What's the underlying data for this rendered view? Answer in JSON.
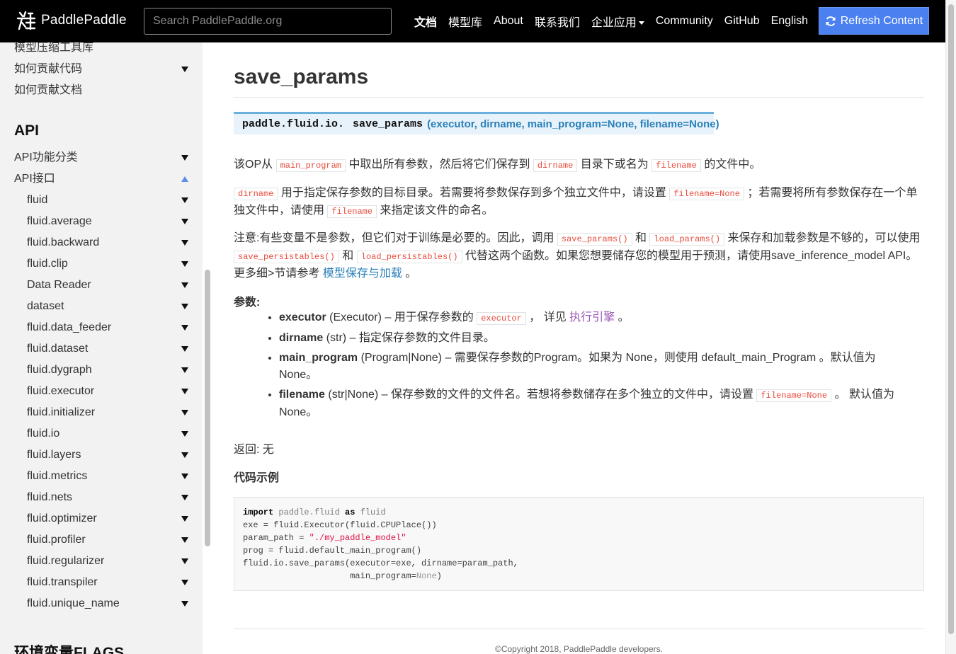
{
  "header": {
    "logo_text": "PaddlePaddle",
    "search_placeholder": "Search PaddlePaddle.org",
    "nav": [
      {
        "label": "文档",
        "active": true
      },
      {
        "label": "模型库"
      },
      {
        "label": "About"
      },
      {
        "label": "联系我们"
      },
      {
        "label": "企业应用",
        "dropdown": true
      },
      {
        "label": "Community"
      },
      {
        "label": "GitHub"
      },
      {
        "label": "English"
      }
    ],
    "refresh_label": "Refresh Content",
    "accent_color": "#4a80f0"
  },
  "sidebar": {
    "top_items": [
      {
        "label": "模型压缩工具库",
        "expander": "none"
      },
      {
        "label": "如何贡献代码",
        "expander": "down"
      },
      {
        "label": "如何贡献文档",
        "expander": "none"
      }
    ],
    "api_heading": "API",
    "api_items": [
      {
        "label": "API功能分类",
        "expander": "down"
      },
      {
        "label": "API接口",
        "expander": "up"
      }
    ],
    "sub_items": [
      {
        "label": "fluid"
      },
      {
        "label": "fluid.average"
      },
      {
        "label": "fluid.backward"
      },
      {
        "label": "fluid.clip"
      },
      {
        "label": "Data Reader"
      },
      {
        "label": "dataset"
      },
      {
        "label": "fluid.data_feeder"
      },
      {
        "label": "fluid.dataset"
      },
      {
        "label": "fluid.dygraph"
      },
      {
        "label": "fluid.executor"
      },
      {
        "label": "fluid.initializer"
      },
      {
        "label": "fluid.io"
      },
      {
        "label": "fluid.layers"
      },
      {
        "label": "fluid.metrics"
      },
      {
        "label": "fluid.nets"
      },
      {
        "label": "fluid.optimizer"
      },
      {
        "label": "fluid.profiler"
      },
      {
        "label": "fluid.regularizer"
      },
      {
        "label": "fluid.transpiler"
      },
      {
        "label": "fluid.unique_name"
      }
    ],
    "bottom_heading": "环境变量FLAGS"
  },
  "doc": {
    "title": "save_params",
    "signature": {
      "prefix": "paddle.fluid.io.",
      "name": "save_params",
      "params": "(executor, dirname, main_program=None, filename=None)"
    },
    "p1": {
      "t1": "该OP从",
      "c1": "main_program",
      "t2": "中取出所有参数，然后将它们保存到",
      "c2": "dirname",
      "t3": "目录下或名为",
      "c3": "filename",
      "t4": "的文件中。"
    },
    "p2": {
      "c1": "dirname",
      "t1": "用于指定保存参数的目标目录。若需要将参数保存到多个独立文件中，请设置",
      "c2": "filename=None",
      "t2": "；若需要将所有参数保存在一个单独文件中，请使用",
      "c3": "filename",
      "t3": "来指定该文件的命名。"
    },
    "p3": {
      "t1": "注意:有些变量不是参数，但它们对于训练是必要的。因此，调用",
      "c1": "save_params()",
      "t2": "和",
      "c2": "load_params()",
      "t3": "来保存和加载参数是不够的，可以使用",
      "c3": "save_persistables()",
      "t4": "和",
      "c4": "load_persistables()",
      "t5": "代替这两个函数。如果您想要储存您的模型用于预测，请使用save_inference_model API。更多细>节请参考",
      "link": "模型保存与加载",
      "t6": "。"
    },
    "params_label": "参数:",
    "params": {
      "executor": {
        "name": "executor",
        "text": "(Executor) – 用于保存参数的",
        "code": "executor",
        "text2": "， 详见",
        "link": "执行引擎",
        "text3": "。"
      },
      "dirname": {
        "name": "dirname",
        "text": "(str) – 指定保存参数的文件目录。"
      },
      "main_program": {
        "name": "main_program",
        "text": "(Program|None) – 需要保存参数的Program。如果为 None，则使用 default_main_Program 。默认值为 None。"
      },
      "filename": {
        "name": "filename",
        "text": "(str|None) – 保存参数的文件的文件名。若想将参数储存在多个独立的文件中，请设置",
        "code": "filename=None",
        "text2": "。 默认值为 None。"
      }
    },
    "returns": "返回: 无",
    "example_heading": "代码示例",
    "code": {
      "l1_kw1": "import",
      "l1_mod": "paddle.fluid",
      "l1_kw2": "as",
      "l1_alias": "fluid",
      "l2": "exe = fluid.Executor(fluid.CPUPlace())",
      "l3_a": "param_path = ",
      "l3_str": "\"./my_paddle_model\"",
      "l4": "prog = fluid.default_main_program()",
      "l5": "fluid.io.save_params(executor=exe, dirname=param_path,",
      "l6_a": "                     main_program=",
      "l6_none": "None",
      "l6_b": ")"
    },
    "footer": "©Copyright 2018, PaddlePaddle developers."
  }
}
